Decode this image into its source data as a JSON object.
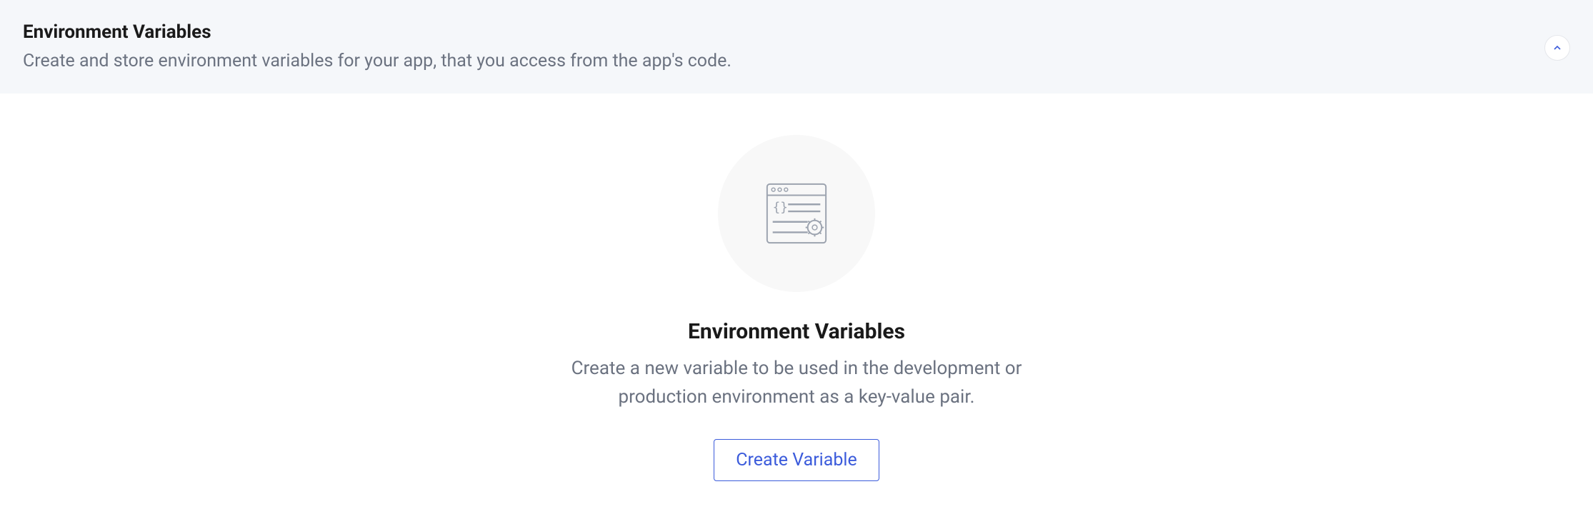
{
  "header": {
    "title": "Environment Variables",
    "subtitle": "Create and store environment variables for your app, that you access from the app's code."
  },
  "emptyState": {
    "title": "Environment Variables",
    "description": "Create a new variable to be used in the development or production environment as a key-value pair.",
    "buttonLabel": "Create Variable"
  }
}
